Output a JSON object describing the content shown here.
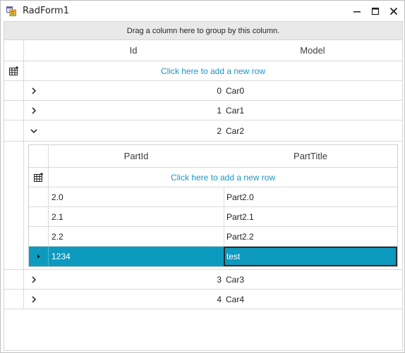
{
  "window": {
    "title": "RadForm1",
    "icons": {
      "app": "app-form-icon",
      "minimize": "minimize-icon",
      "maximize": "maximize-icon",
      "close": "close-icon"
    }
  },
  "grid": {
    "group_panel_text": "Drag a column here to group by this column.",
    "columns": {
      "id": "Id",
      "model": "Model"
    },
    "add_new_row": "Click here to add a new row",
    "rows": [
      {
        "id": "0",
        "model": "Car0",
        "expanded": false
      },
      {
        "id": "1",
        "model": "Car1",
        "expanded": false
      },
      {
        "id": "2",
        "model": "Car2",
        "expanded": true
      },
      {
        "id": "3",
        "model": "Car3",
        "expanded": false
      },
      {
        "id": "4",
        "model": "Car4",
        "expanded": false
      }
    ],
    "child": {
      "columns": {
        "part_id": "PartId",
        "part_title": "PartTitle"
      },
      "add_new_row": "Click here to add a new row",
      "rows": [
        {
          "part_id": "2.0",
          "part_title": "Part2.0",
          "selected": false
        },
        {
          "part_id": "2.1",
          "part_title": "Part2.1",
          "selected": false
        },
        {
          "part_id": "2.2",
          "part_title": "Part2.2",
          "selected": false
        },
        {
          "part_id": "1234",
          "part_title": "test",
          "selected": true
        }
      ]
    },
    "colors": {
      "accent": "#1a96c4",
      "selected_row": "#0c9bbf",
      "group_panel": "#e9e9e9",
      "grid_line": "#dadada"
    }
  }
}
